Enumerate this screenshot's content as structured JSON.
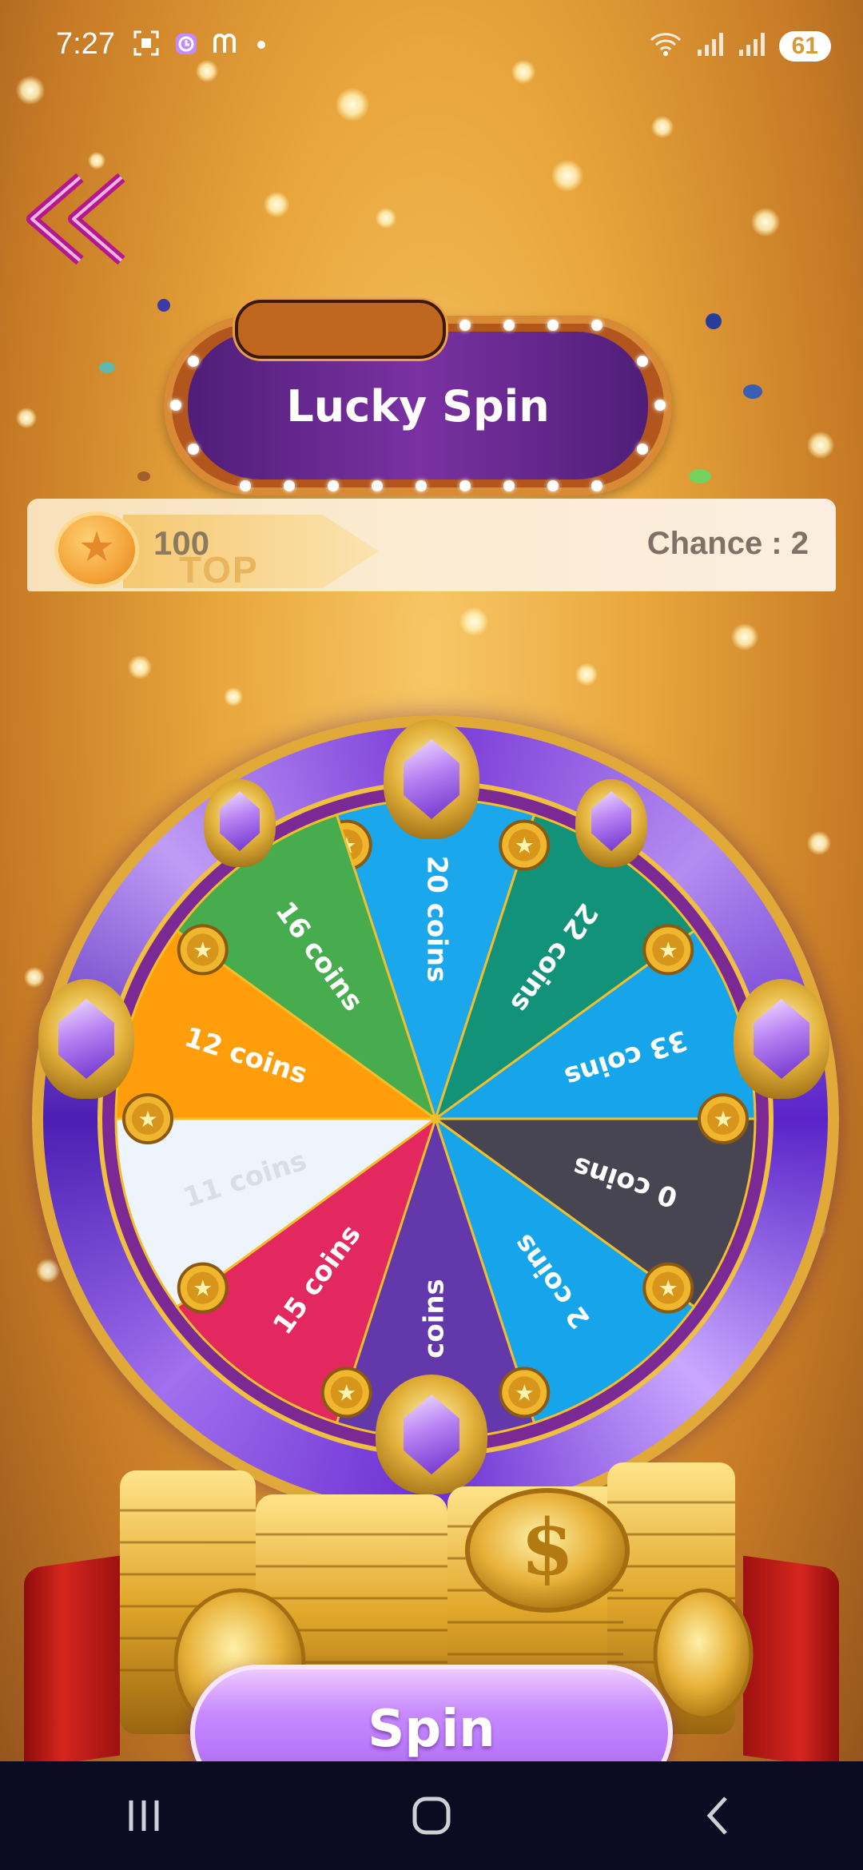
{
  "status_bar": {
    "time": "7:27",
    "battery": "61",
    "left_icons": [
      "screenshot-icon",
      "alarm-icon",
      "m-app-icon",
      "dot-icon"
    ],
    "right_icons": [
      "wifi-icon",
      "signal-icon",
      "signal-icon",
      "battery-icon"
    ]
  },
  "header": {
    "back_icon": "double-chevron-left-icon",
    "title": "Lucky Spin"
  },
  "info_bar": {
    "coin_count": "100",
    "banner_text": "TOP",
    "chance_label": "Chance : 2"
  },
  "wheel": {
    "segments": [
      {
        "label": "20 coins",
        "color": "#1aa7ec"
      },
      {
        "label": "22 coins",
        "color": "#129279"
      },
      {
        "label": "33 coins",
        "color": "#16a5eb"
      },
      {
        "label": "0 coins",
        "color": "#474552"
      },
      {
        "label": "2 coins",
        "color": "#16a5eb"
      },
      {
        "label": "coins",
        "color": "#6238aa"
      },
      {
        "label": "15 coins",
        "color": "#e32860"
      },
      {
        "label": "11 coins",
        "color": "#eef4fb"
      },
      {
        "label": "12 coins",
        "color": "#ff9e0a"
      },
      {
        "label": "16 coins",
        "color": "#47ac4d"
      }
    ],
    "divider_color": "#f2bf2a"
  },
  "spin_button": {
    "label": "Spin"
  },
  "nav": {
    "recents_icon": "recents-icon",
    "home_icon": "home-icon",
    "back_icon": "back-icon"
  }
}
